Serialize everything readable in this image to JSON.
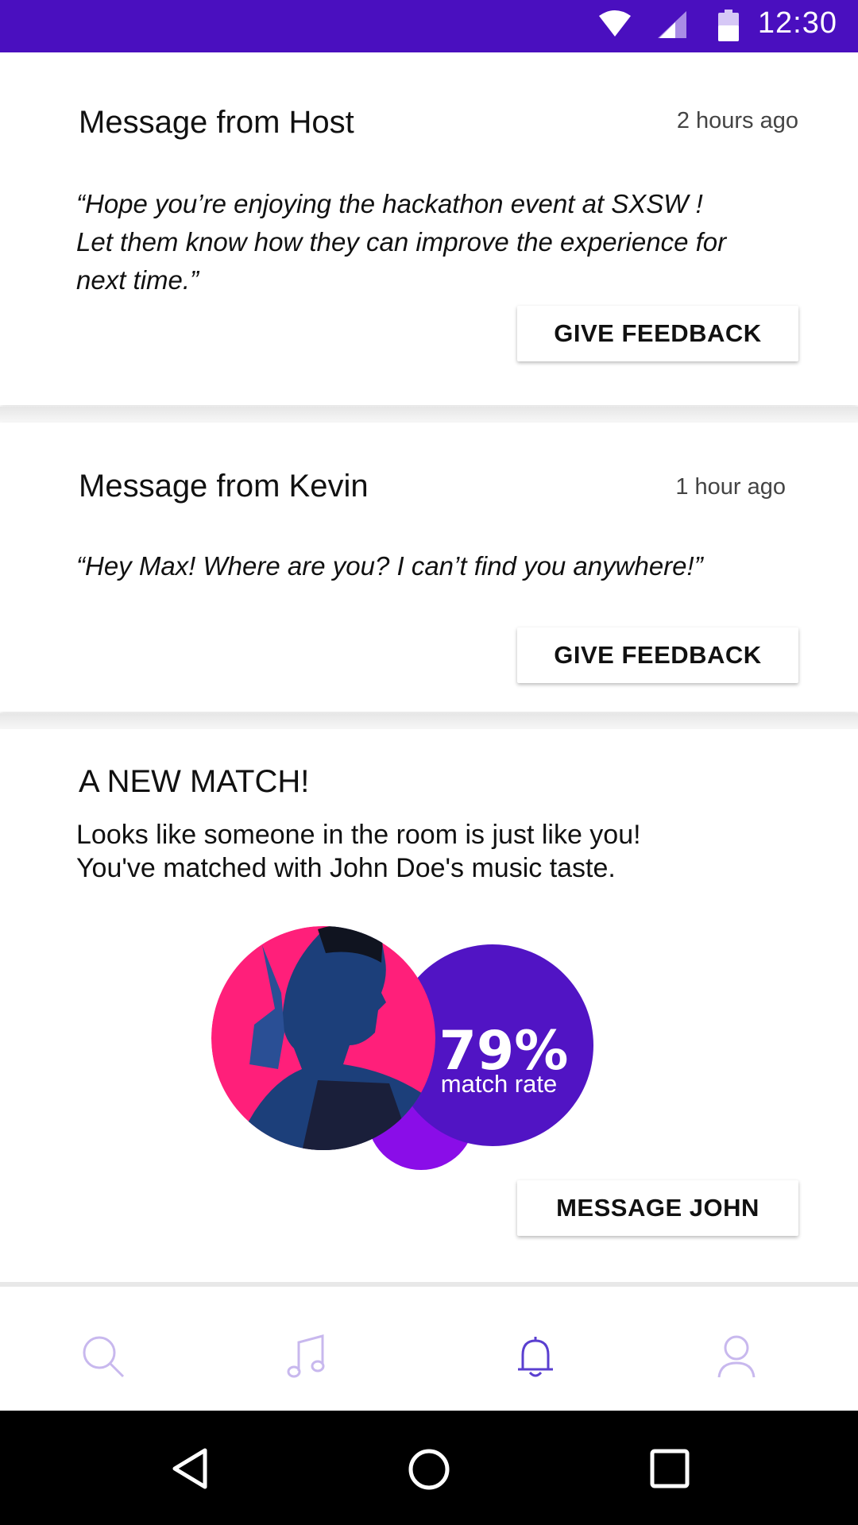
{
  "status_bar": {
    "time": "12:30",
    "icons": [
      "wifi-icon",
      "cellular-signal-icon",
      "battery-icon"
    ],
    "background": "#4a0fbf"
  },
  "cards": [
    {
      "title": "Message from Host",
      "time": "2 hours ago",
      "quote_lines": [
        "“Hope you’re enjoying the hackathon event at SXSW !",
        "Let them know how they can improve the experience for",
        "next time.”"
      ],
      "button": "GIVE FEEDBACK"
    },
    {
      "title": "Message from Kevin",
      "time": "1 hour ago",
      "quote_lines": [
        "“Hey Max! Where are you? I can’t find you anywhere!”"
      ],
      "button": "GIVE FEEDBACK"
    }
  ],
  "match": {
    "title": "A NEW MATCH!",
    "description_lines": [
      "Looks like someone in the room is just like you!",
      "You've matched with John Doe's music taste."
    ],
    "percent": "79%",
    "rate_label": "match rate",
    "button": "MESSAGE JOHN",
    "colors": {
      "pink": "#ff1f7a",
      "purple": "#5114c4",
      "violet": "#8a0de8"
    }
  },
  "bottom_nav": {
    "items": [
      "search-icon",
      "music-note-icon",
      "bell-icon",
      "person-icon"
    ],
    "active": "bell-icon",
    "active_color": "#5a3fd0",
    "inactive_color": "#c8b8ee"
  },
  "system_nav": {
    "items": [
      "back-icon",
      "home-icon",
      "recents-icon"
    ]
  }
}
